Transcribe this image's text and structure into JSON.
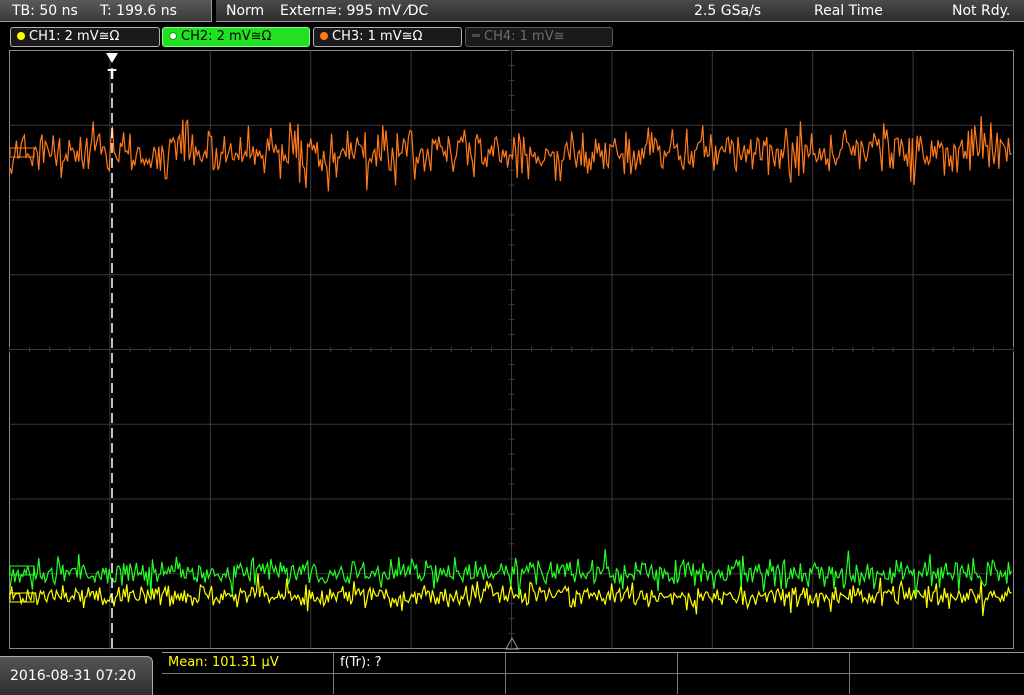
{
  "topbar": {
    "timebase": "TB: 50 ns",
    "trigger_time": "T: 199.6 ns",
    "trigger_mode": "Norm",
    "trigger_source": "Extern≅: 995 mV ⁄DC",
    "sample_rate": "2.5 GSa/s",
    "acq_mode": "Real Time",
    "status": "Not Rdy."
  },
  "channels": [
    {
      "label": "CH1: 2 mV≅Ω",
      "color": "#ffff00"
    },
    {
      "label": "CH2: 2 mV≅Ω",
      "color": "#22ff22"
    },
    {
      "label": "CH3: 1 mV≅Ω",
      "color": "#ff7a1a"
    },
    {
      "label": "CH4: 1 mV≅",
      "color": "#6c6c6c"
    }
  ],
  "display": {
    "trigger_marker": "T",
    "grid_color": "#3a3a3a",
    "frame_color": "#8a8a8a"
  },
  "bottom": {
    "datetime": "2016-08-31 07:20",
    "measurements": {
      "mean": "Mean: 101.31 µV",
      "ftr": "f(Tr): ?"
    }
  }
}
